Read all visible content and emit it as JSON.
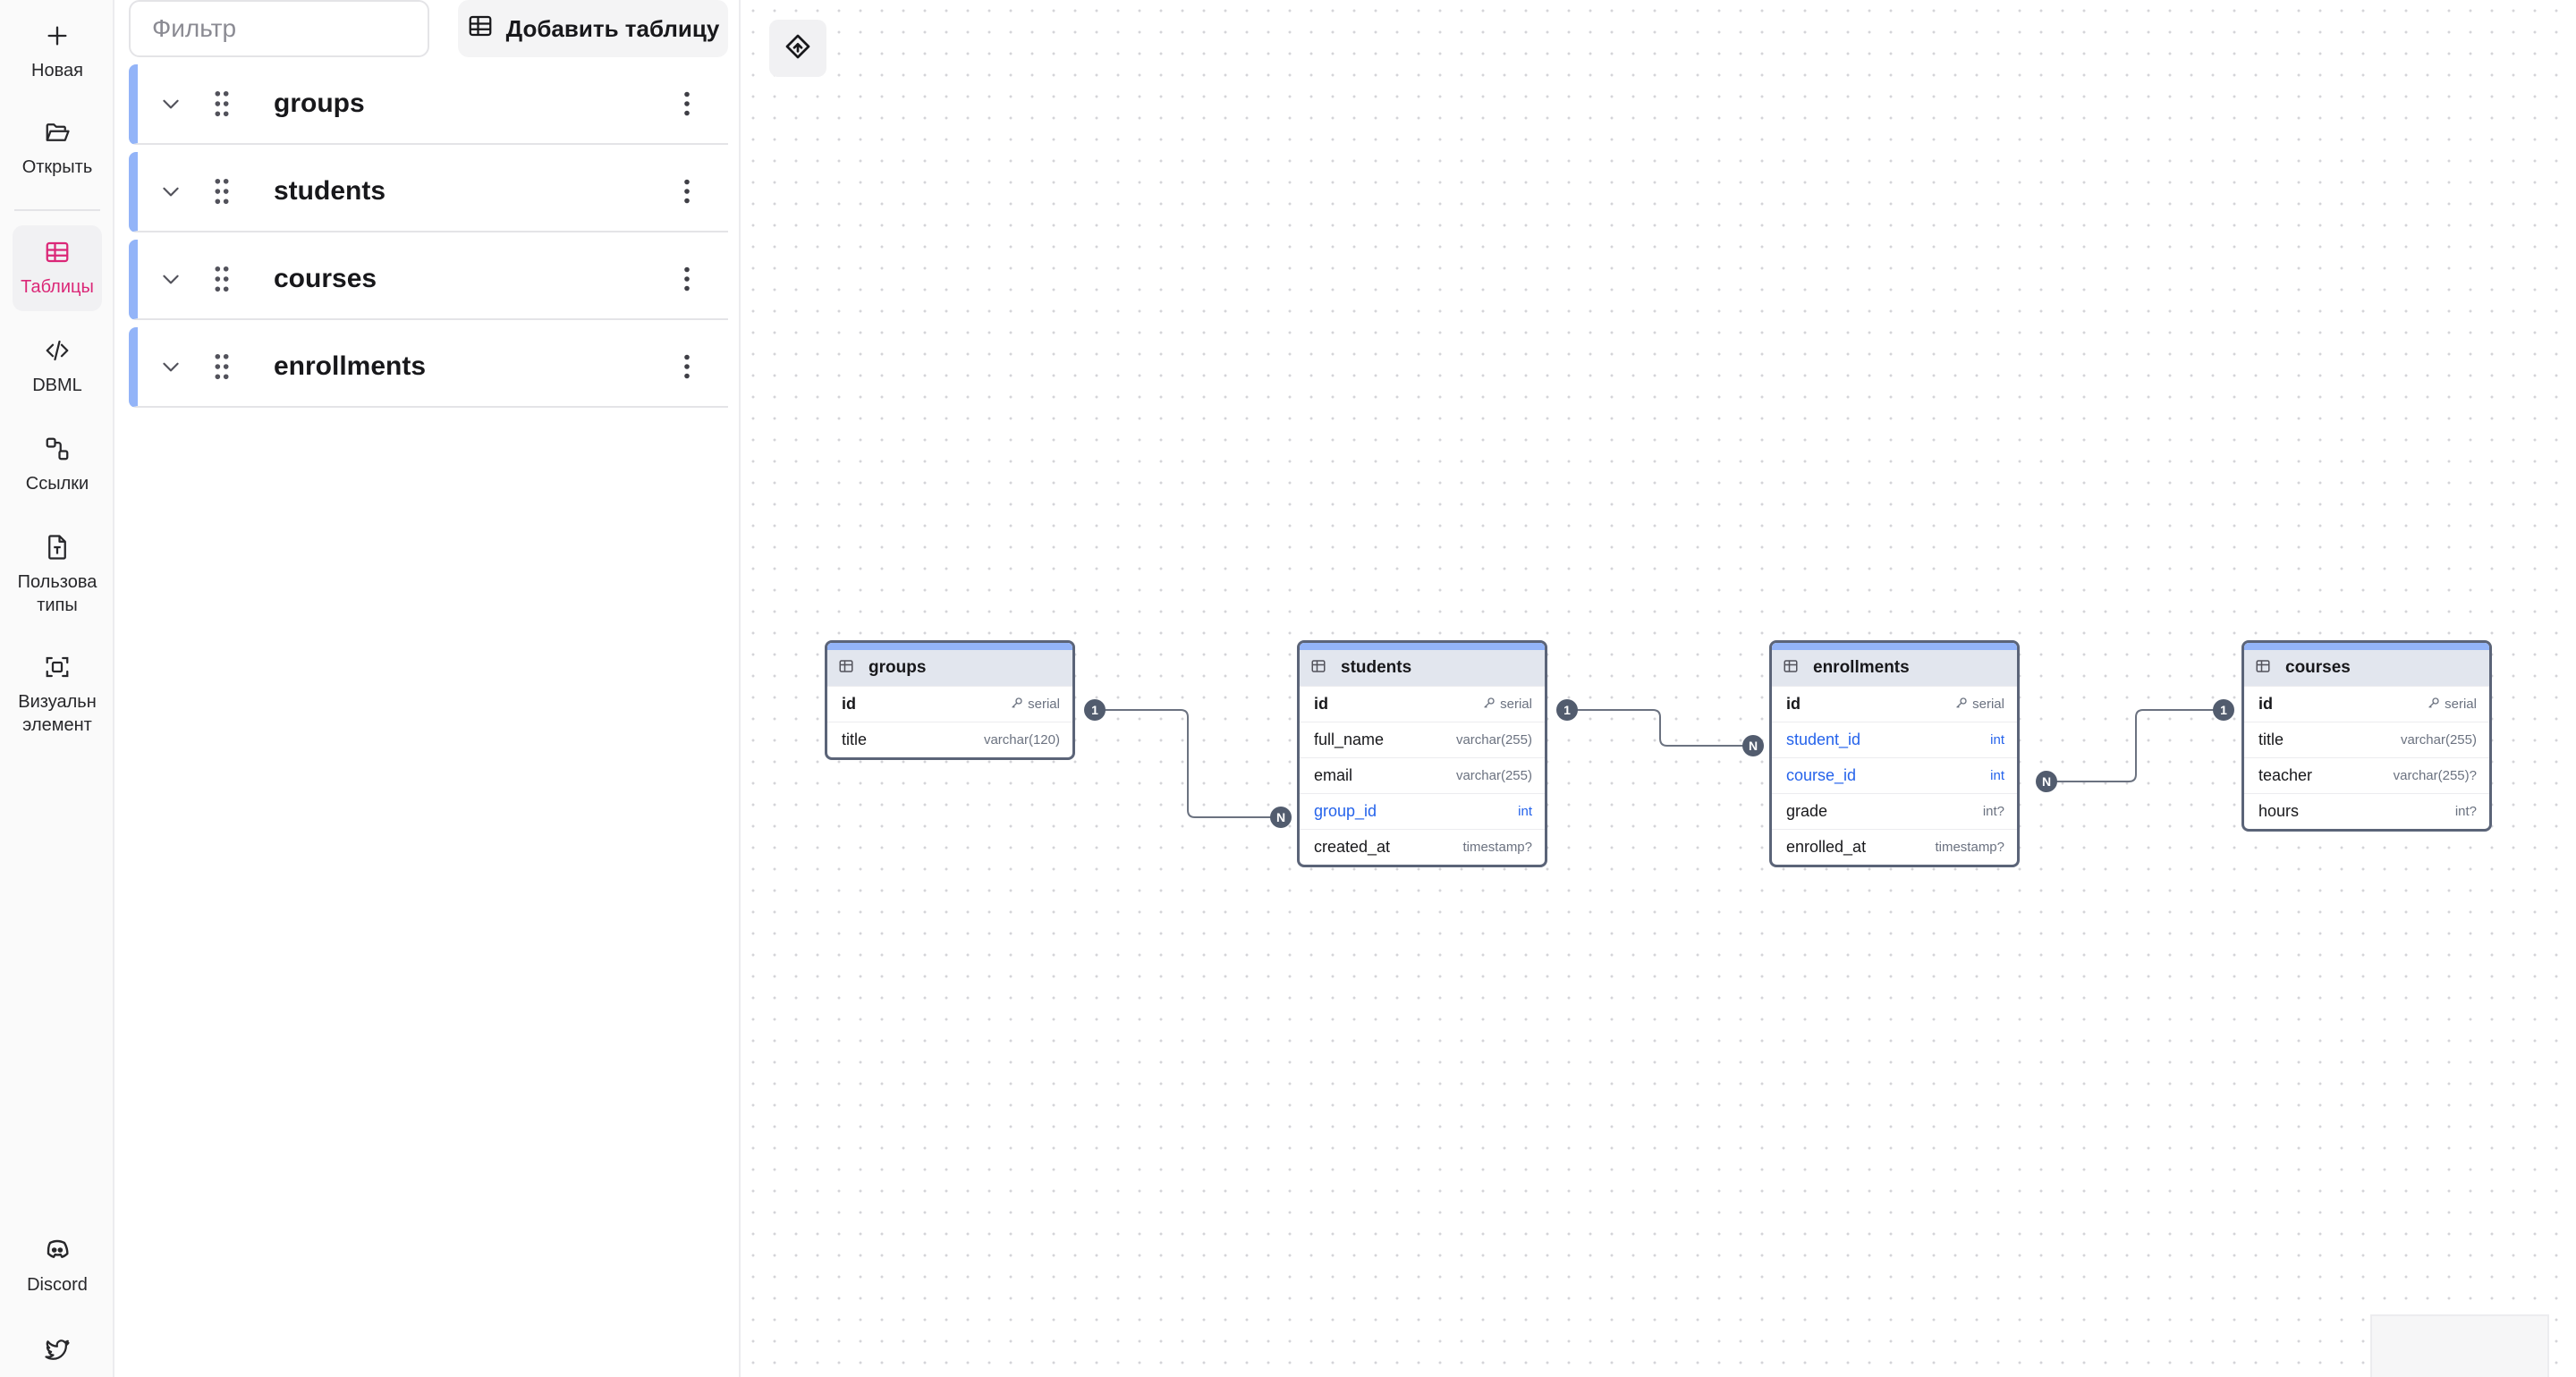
{
  "rail": {
    "new": "Новая",
    "open": "Открыть",
    "tables": "Таблицы",
    "dbml": "DBML",
    "links": "Ссылки",
    "user_types": "Пользова\nтипы",
    "visual": "Визуальн\nэлемент",
    "discord": "Discord"
  },
  "panel": {
    "filter_placeholder": "Фильтр",
    "add_table": "Добавить таблицу",
    "tables": [
      "groups",
      "students",
      "courses",
      "enrollments"
    ]
  },
  "accent": "#db2777",
  "table_color": "#93b4f8",
  "er": {
    "groups": {
      "name": "groups",
      "fields": [
        {
          "name": "id",
          "type": "serial",
          "pk": true
        },
        {
          "name": "title",
          "type": "varchar(120)"
        }
      ]
    },
    "students": {
      "name": "students",
      "fields": [
        {
          "name": "id",
          "type": "serial",
          "pk": true
        },
        {
          "name": "full_name",
          "type": "varchar(255)"
        },
        {
          "name": "email",
          "type": "varchar(255)"
        },
        {
          "name": "group_id",
          "type": "int",
          "fk": true
        },
        {
          "name": "created_at",
          "type": "timestamp?"
        }
      ]
    },
    "enrollments": {
      "name": "enrollments",
      "fields": [
        {
          "name": "id",
          "type": "serial",
          "pk": true
        },
        {
          "name": "student_id",
          "type": "int",
          "fk": true
        },
        {
          "name": "course_id",
          "type": "int",
          "fk": true
        },
        {
          "name": "grade",
          "type": "int?"
        },
        {
          "name": "enrolled_at",
          "type": "timestamp?"
        }
      ]
    },
    "courses": {
      "name": "courses",
      "fields": [
        {
          "name": "id",
          "type": "serial",
          "pk": true
        },
        {
          "name": "title",
          "type": "varchar(255)"
        },
        {
          "name": "teacher",
          "type": "varchar(255)?"
        },
        {
          "name": "hours",
          "type": "int?"
        }
      ]
    }
  },
  "relations": {
    "one": "1",
    "many": "N"
  }
}
